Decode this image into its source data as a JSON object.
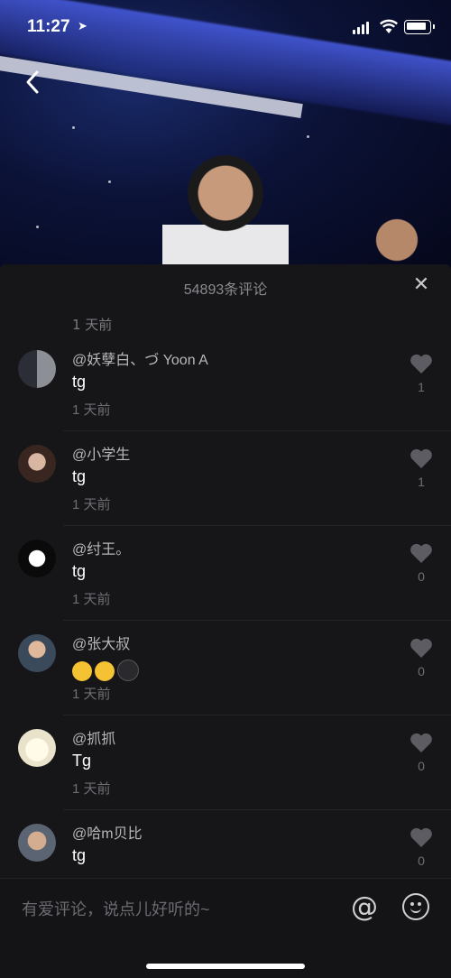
{
  "status_bar": {
    "time": "11:27"
  },
  "panel": {
    "title": "54893条评论",
    "stub_time": "1 天前"
  },
  "comments": [
    {
      "user": "@妖孽白、づ Yoon A",
      "text": "tg",
      "time": "1 天前",
      "likes": "1",
      "avatar_color": "#5b6068"
    },
    {
      "user": "@小学生",
      "text": "tg",
      "time": "1 天前",
      "likes": "1",
      "avatar_color": "#6a4a3c"
    },
    {
      "user": "@纣王。",
      "text": "tg",
      "time": "1 天前",
      "likes": "0",
      "avatar_color": "#0a0a0a"
    },
    {
      "user": "@张大叔",
      "text": "",
      "emoji": [
        "heart-eyes-emoji",
        "crying-emoji",
        "sweat-emoji"
      ],
      "time": "1 天前",
      "likes": "0",
      "avatar_color": "#a07a66"
    },
    {
      "user": "@抓抓",
      "text": "Tg",
      "time": "1 天前",
      "likes": "0",
      "avatar_color": "#f2efe4"
    },
    {
      "user": "@哈m贝比",
      "text": "tg",
      "time": "",
      "likes": "0",
      "avatar_color": "#c9a98e"
    }
  ],
  "input": {
    "placeholder": "有爱评论，说点儿好听的~"
  },
  "colors": {
    "panel_bg": "#161618",
    "muted_text": "#6e6e74",
    "heart": "#5c5c62"
  }
}
